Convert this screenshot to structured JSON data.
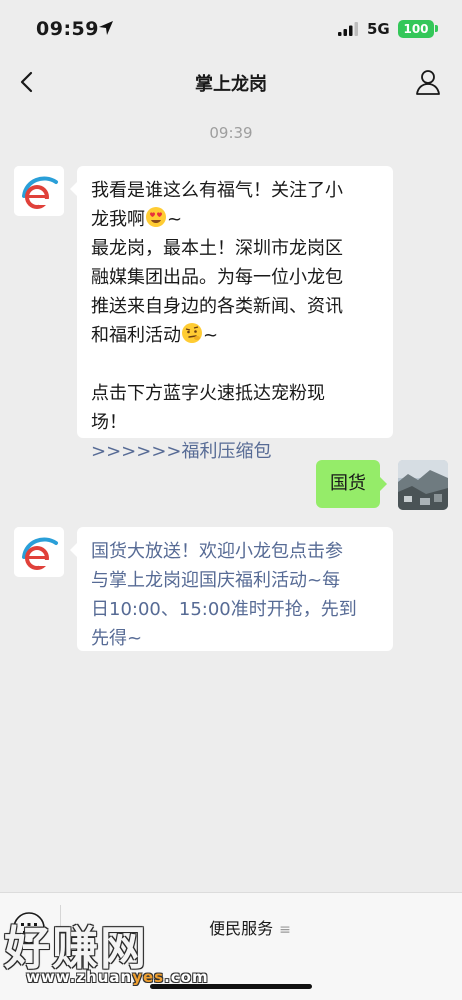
{
  "status_bar": {
    "time": "09:59",
    "network": "5G",
    "battery": "100",
    "accent_color": "#34c759"
  },
  "nav": {
    "title": "掌上龙岗",
    "back_icon": "chevron-left-icon",
    "user_icon": "person-icon"
  },
  "chat": {
    "timestamp": "09:39",
    "messages": [
      {
        "sender": "official-account",
        "lines": [
          "我看是谁这么有福气！关注了小",
          "龙我啊",
          "最龙岗，最本土！深圳市龙岗区",
          "融媒集团出品。为每一位小龙包",
          "推送来自身边的各类新闻、资讯",
          "和福利活动",
          "点击下方蓝字火速抵达宠粉现",
          "场！"
        ],
        "line2_suffix": "~",
        "line6_suffix": "~",
        "link": ">>>>>>福利压缩包",
        "emojis": [
          "heart-eyes-emoji",
          "skeptical-emoji"
        ]
      },
      {
        "sender": "me",
        "text": "国货"
      },
      {
        "sender": "official-account",
        "lines": [
          "国货大放送！欢迎小龙包点击参",
          "与掌上龙岗迎国庆福利活动~每",
          "日10:00、15:00准时开抢，先到",
          "先得~"
        ],
        "link_color": "#576b95"
      }
    ]
  },
  "bottom_menu": {
    "item_label": "便民服务",
    "item_glyph": "≡",
    "keyboard_icon": "keyboard-toggle-icon"
  },
  "watermark": {
    "big_text": "好赚网",
    "site_a": "www.zhuan",
    "site_b": "yes",
    "site_c": ".com"
  },
  "colors": {
    "background": "#ededed",
    "bubble_me": "#95ec69",
    "link": "#576b95"
  }
}
